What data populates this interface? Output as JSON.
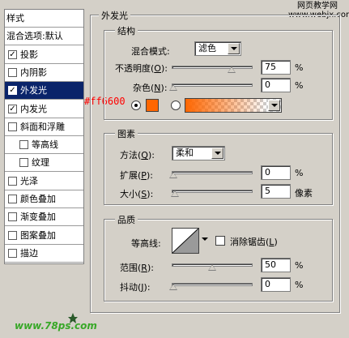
{
  "colors": {
    "selection_bg": "#0a246a",
    "glow_color": "#ff6600",
    "annotation_red": "#ff0000",
    "gradient_end": "#ffffff",
    "watermark_green": "#38a828"
  },
  "header_watermark": "网页教学网\nwww.webjx.com",
  "annotation": "#ff6600",
  "footer_watermark": "www.78ps.com",
  "style_list": {
    "header": "样式",
    "items": [
      {
        "label": "混合选项:默认",
        "has_checkbox": false
      },
      {
        "label": "投影",
        "checked": true
      },
      {
        "label": "内阴影",
        "checked": false
      },
      {
        "label": "外发光",
        "checked": true,
        "selected": true
      },
      {
        "label": "内发光",
        "checked": true
      },
      {
        "label": "斜面和浮雕",
        "checked": false
      },
      {
        "label": "等高线",
        "checked": false,
        "indent": true
      },
      {
        "label": "纹理",
        "checked": false,
        "indent": true
      },
      {
        "label": "光泽",
        "checked": false
      },
      {
        "label": "颜色叠加",
        "checked": false
      },
      {
        "label": "渐变叠加",
        "checked": false
      },
      {
        "label": "图案叠加",
        "checked": false
      },
      {
        "label": "描边",
        "checked": false
      }
    ]
  },
  "panel": {
    "title": "外发光",
    "structure": {
      "title": "结构",
      "blend_mode_label": "混合模式:",
      "blend_mode_value": "滤色",
      "opacity_label": "不透明度",
      "opacity_key": "O",
      "opacity_value": "75",
      "opacity_unit": "%",
      "opacity_level": 0.75,
      "noise_label": "杂色",
      "noise_key": "N",
      "noise_value": "0",
      "noise_unit": "%",
      "noise_level": 0.0,
      "color_radio_selected": "solid"
    },
    "elements": {
      "title": "图素",
      "method_label": "方法",
      "method_key": "Q",
      "method_value": "柔和",
      "spread_label": "扩展",
      "spread_key": "P",
      "spread_value": "0",
      "spread_unit": "%",
      "spread_level": 0.0,
      "size_label": "大小",
      "size_key": "S",
      "size_value": "5",
      "size_unit": "像素",
      "size_level": 0.02
    },
    "quality": {
      "title": "品质",
      "contour_label": "等高线:",
      "antialias_label": "消除锯齿",
      "antialias_key": "L",
      "antialias_checked": false,
      "range_label": "范围",
      "range_key": "R",
      "range_value": "50",
      "range_unit": "%",
      "range_level": 0.5,
      "jitter_label": "抖动",
      "jitter_key": "J",
      "jitter_value": "0",
      "jitter_unit": "%",
      "jitter_level": 0.0
    }
  }
}
